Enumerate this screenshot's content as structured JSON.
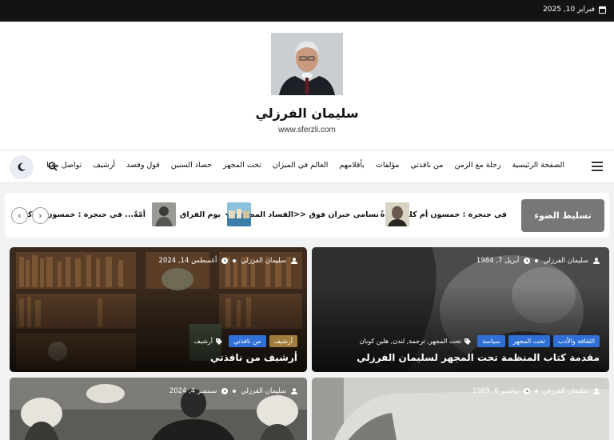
{
  "topbar": {
    "date": "فبراير 10, 2025"
  },
  "header": {
    "title": "سليمان الفرزلي",
    "url": "www.sferzli.com"
  },
  "nav": {
    "items": [
      "الصفحة الرئيسية",
      "رحلة مع الزمن",
      "من نافذتي",
      "مؤلفات",
      "بأقلامهم",
      "العالم في الميزان",
      "تحت المجهر",
      "حصاد السنين",
      "قول وقصد",
      "أرشيف",
      "تواصل معنا"
    ]
  },
  "ticker": {
    "label": "تسليط الضوء",
    "items": [
      "في حنجرة : خمسون أم كلثوم ...ةً",
      "تسامي جبران فوق <<الفساد المطلق>>",
      "يوم الفراق",
      "أمّةٌ... في حنجرة : خمسون أم كلثا"
    ]
  },
  "cards": [
    {
      "author": "سليمان الفرزلي",
      "date": "أبريل 7, 1984",
      "tags": [
        "الثقافة والأدب",
        "تحت المجهر",
        "سياسة"
      ],
      "keywords": "تحت المجهر, ترجمة, لندن, هلين كوبان",
      "title": "مقدمة كتاب المنظمة تحت المجهر لسليمان الفرزلي"
    },
    {
      "author": "سليمان الفرزلي",
      "date": "أغسطس 14, 2024",
      "tags": [
        "من نافذتي",
        "أرشيف"
      ],
      "keywords": "أرشيف",
      "title": "أرشيف من نافذتي"
    },
    {
      "author": "سليمان الفرزلي",
      "date": "نوفمبر 6, 1989"
    },
    {
      "author": "سليمان الفرزلي",
      "date": "سبتمبر 4, 2024"
    }
  ]
}
